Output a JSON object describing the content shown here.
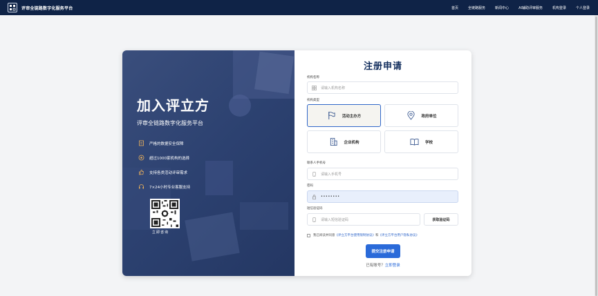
{
  "header": {
    "brand": "评审全链路数字化服务平台",
    "nav": [
      "首页",
      "全链路服务",
      "新闻中心",
      "AI辅助评审服务",
      "机构登录",
      "个人登录"
    ]
  },
  "promo": {
    "title": "加入评立方",
    "subtitle": "评审全链路数字化服务平台",
    "features": [
      {
        "icon": "document-icon",
        "text": "严格的数据安全保障"
      },
      {
        "icon": "target-icon",
        "text": "超过1000家机构的选择"
      },
      {
        "icon": "thumbs-up-icon",
        "text": "支持各类活动评审需求"
      },
      {
        "icon": "headset-icon",
        "text": "7×24小时专业客服支持"
      }
    ],
    "qr_label": "立即咨询"
  },
  "form": {
    "title": "注册申请",
    "org_name_label": "机构名称",
    "org_name_placeholder": "请输入机构名称",
    "org_type_label": "机构类型",
    "org_types": [
      {
        "icon": "flag-icon",
        "label": "活动主办方",
        "selected": true
      },
      {
        "icon": "location-pin-icon",
        "label": "政府单位",
        "selected": false
      },
      {
        "icon": "building-icon",
        "label": "企业机构",
        "selected": false
      },
      {
        "icon": "book-icon",
        "label": "学校",
        "selected": false
      }
    ],
    "phone_label": "联系人手机号",
    "phone_placeholder": "请输入手机号",
    "password_label": "密码",
    "password_value": "••••••••",
    "sms_label": "短信验证码",
    "sms_placeholder": "请输入短信验证码",
    "sms_button": "获取验证码",
    "agree_prefix": "我已阅读并同意",
    "agree_link1": "《评立方平台使用限制协议》",
    "agree_and": "和",
    "agree_link2": "《评立方平台用户隐私协议》",
    "submit": "提交注册申请",
    "login_prefix": "已有账号？",
    "login_link": "立即登录"
  },
  "colors": {
    "nav_bg": "#0f2347",
    "accent": "#2a6ad9",
    "title": "#0f2b5b"
  }
}
